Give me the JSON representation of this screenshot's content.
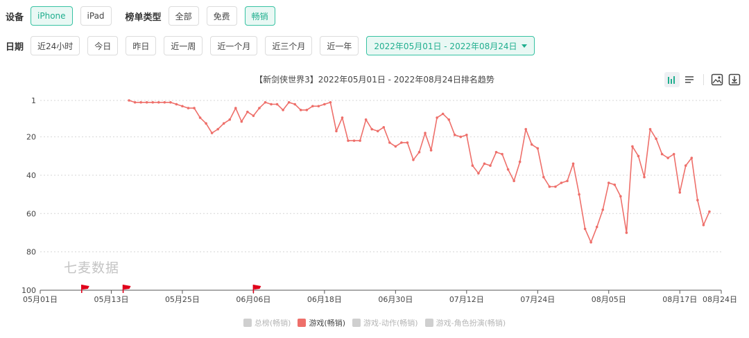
{
  "filters": {
    "device": {
      "label": "设备",
      "options": [
        "iPhone",
        "iPad"
      ],
      "selected": 0
    },
    "chart_type": {
      "label": "榜单类型",
      "options": [
        "全部",
        "免费",
        "畅销"
      ],
      "selected": 2
    },
    "date": {
      "label": "日期",
      "options": [
        "近24小时",
        "今日",
        "昨日",
        "近一周",
        "近一个月",
        "近三个月",
        "近一年"
      ],
      "range": "2022年05月01日 - 2022年08月24日"
    }
  },
  "watermark": "七麦数据",
  "colors": {
    "accent": "#1fae8e",
    "line": "#ee6f6a",
    "flag": "#e0001a",
    "legend_inactive": "#cfcfcf"
  },
  "toolbar_icons": [
    "bar-chart-icon",
    "list-icon",
    "image-icon",
    "download-icon"
  ],
  "chart_data": {
    "type": "line",
    "title": "【新剑侠世界3】2022年05月01日 - 2022年08月24日排名趋势",
    "xlabel": "",
    "ylabel": "",
    "y_inverted": true,
    "ylim": [
      1,
      100
    ],
    "y_ticks": [
      1,
      20,
      40,
      60,
      80,
      100
    ],
    "x_ticks": [
      "05月01日",
      "05月13日",
      "05月25日",
      "06月06日",
      "06月18日",
      "06月30日",
      "07月12日",
      "07月24日",
      "08月05日",
      "08月17日",
      "08月24日"
    ],
    "grid": true,
    "legend_position": "bottom",
    "legend": [
      {
        "name": "总榜(畅销)",
        "active": false
      },
      {
        "name": "游戏(畅销)",
        "active": true
      },
      {
        "name": "游戏-动作(畅销)",
        "active": false
      },
      {
        "name": "游戏-角色扮演(畅销)",
        "active": false
      }
    ],
    "flags_x_day": [
      7,
      14,
      36
    ],
    "series": [
      {
        "name": "游戏(畅销)",
        "points": [
          [
            15,
            1
          ],
          [
            16,
            2
          ],
          [
            17,
            2
          ],
          [
            18,
            2
          ],
          [
            19,
            2
          ],
          [
            20,
            2
          ],
          [
            21,
            2
          ],
          [
            22,
            2
          ],
          [
            23,
            3
          ],
          [
            24,
            4
          ],
          [
            25,
            5
          ],
          [
            26,
            5
          ],
          [
            27,
            10
          ],
          [
            28,
            13
          ],
          [
            29,
            18
          ],
          [
            30,
            16
          ],
          [
            31,
            13
          ],
          [
            32,
            11
          ],
          [
            33,
            5
          ],
          [
            34,
            12
          ],
          [
            35,
            7
          ],
          [
            36,
            9
          ],
          [
            37,
            5
          ],
          [
            38,
            2
          ],
          [
            39,
            3
          ],
          [
            40,
            3
          ],
          [
            41,
            6
          ],
          [
            42,
            2
          ],
          [
            43,
            3
          ],
          [
            44,
            6
          ],
          [
            45,
            6
          ],
          [
            46,
            4
          ],
          [
            47,
            4
          ],
          [
            48,
            3
          ],
          [
            49,
            2
          ],
          [
            50,
            17
          ],
          [
            51,
            10
          ],
          [
            52,
            22
          ],
          [
            53,
            22
          ],
          [
            54,
            22
          ],
          [
            55,
            11
          ],
          [
            56,
            16
          ],
          [
            57,
            17
          ],
          [
            58,
            15
          ],
          [
            59,
            23
          ],
          [
            60,
            25
          ],
          [
            61,
            23
          ],
          [
            62,
            23
          ],
          [
            63,
            32
          ],
          [
            64,
            28
          ],
          [
            65,
            18
          ],
          [
            66,
            27
          ],
          [
            67,
            10
          ],
          [
            68,
            8
          ],
          [
            69,
            11
          ],
          [
            70,
            19
          ],
          [
            71,
            20
          ],
          [
            72,
            19
          ],
          [
            73,
            35
          ],
          [
            74,
            39
          ],
          [
            75,
            34
          ],
          [
            76,
            35
          ],
          [
            77,
            28
          ],
          [
            78,
            29
          ],
          [
            79,
            37
          ],
          [
            80,
            43
          ],
          [
            81,
            33
          ],
          [
            82,
            16
          ],
          [
            83,
            24
          ],
          [
            84,
            26
          ],
          [
            85,
            41
          ],
          [
            86,
            46
          ],
          [
            87,
            46
          ],
          [
            88,
            44
          ],
          [
            89,
            43
          ],
          [
            90,
            34
          ],
          [
            91,
            50
          ],
          [
            92,
            68
          ],
          [
            93,
            75
          ],
          [
            94,
            67
          ],
          [
            95,
            58
          ],
          [
            96,
            44
          ],
          [
            97,
            45
          ],
          [
            98,
            51
          ],
          [
            99,
            70
          ],
          [
            100,
            25
          ],
          [
            101,
            30
          ],
          [
            102,
            41
          ],
          [
            103,
            16
          ],
          [
            104,
            21
          ],
          [
            105,
            29
          ],
          [
            106,
            31
          ],
          [
            107,
            29
          ],
          [
            108,
            49
          ],
          [
            109,
            35
          ],
          [
            110,
            31
          ],
          [
            111,
            53
          ],
          [
            112,
            66
          ],
          [
            113,
            59
          ]
        ]
      }
    ]
  }
}
